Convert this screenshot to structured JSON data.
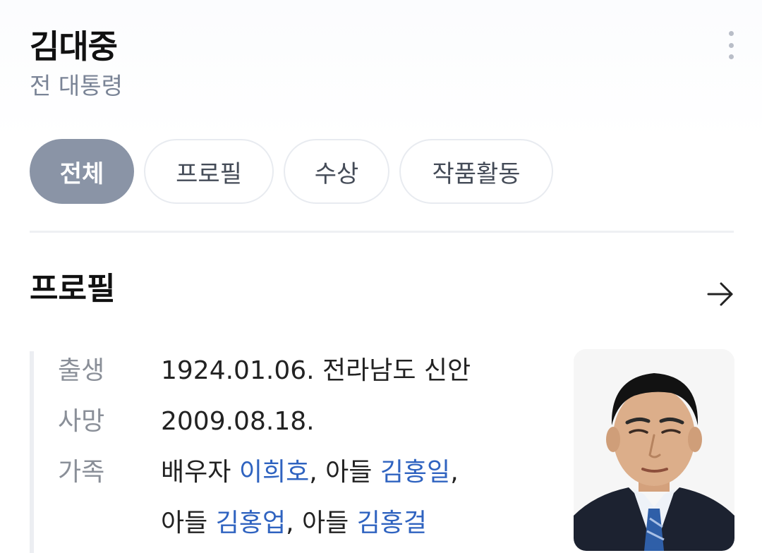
{
  "header": {
    "title": "김대중",
    "subtitle": "전 대통령"
  },
  "tabs": [
    {
      "label": "전체",
      "active": true
    },
    {
      "label": "프로필",
      "active": false
    },
    {
      "label": "수상",
      "active": false
    },
    {
      "label": "작품활동",
      "active": false
    }
  ],
  "profile": {
    "section_title": "프로필",
    "birth": {
      "label": "출생",
      "value": "1924.01.06. 전라남도 신안"
    },
    "death": {
      "label": "사망",
      "value": "2009.08.18."
    },
    "family": {
      "label": "가족",
      "spouse_relation": "배우자",
      "spouse_name": "이희호",
      "son_relation": "아들",
      "son1_name": "김홍일",
      "son2_name": "김홍업",
      "son3_name": "김홍걸",
      "separator": ","
    }
  },
  "colors": {
    "accent_link": "#2f63c0",
    "active_tab": "#8a94a6",
    "subtitle": "#7a8496"
  },
  "icons": {
    "more": "more-vertical-icon",
    "arrow": "arrow-right-icon"
  }
}
